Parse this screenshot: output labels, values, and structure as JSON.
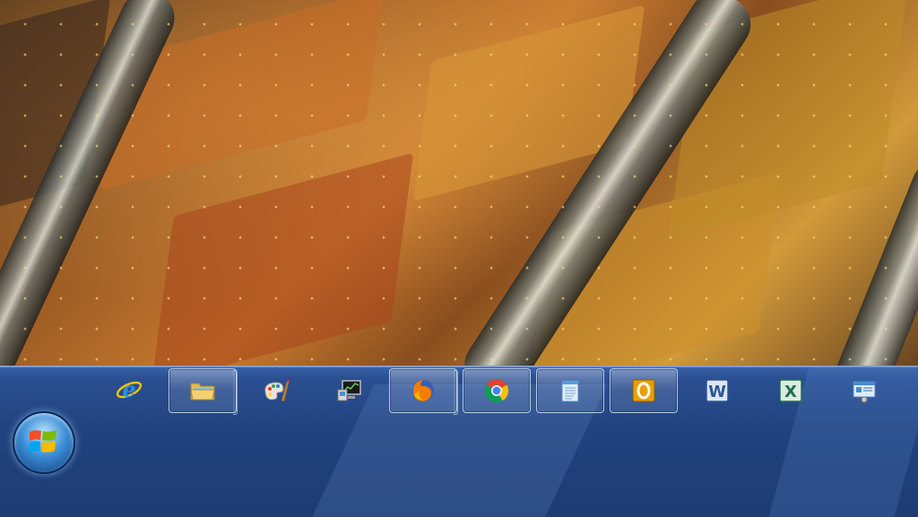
{
  "desktop": {
    "wallpaper": "woven-orange-abstract"
  },
  "taskbar": {
    "start_button": {
      "icon": "windows-logo-icon"
    },
    "items": [
      {
        "name": "internet-explorer",
        "icon": "internet-explorer-icon",
        "active": false
      },
      {
        "name": "windows-explorer",
        "icon": "folder-icon",
        "active": true
      },
      {
        "name": "paint",
        "icon": "paint-palette-icon",
        "active": false
      },
      {
        "name": "remote-desktop",
        "icon": "monitor-icon",
        "active": false
      },
      {
        "name": "firefox",
        "icon": "firefox-icon",
        "active": true
      },
      {
        "name": "chrome",
        "icon": "chrome-icon",
        "active": true
      },
      {
        "name": "notepad",
        "icon": "notepad-icon",
        "active": true
      },
      {
        "name": "outlook",
        "icon": "outlook-icon",
        "active": true
      },
      {
        "name": "word",
        "icon": "word-icon",
        "active": false
      },
      {
        "name": "excel",
        "icon": "excel-icon",
        "active": false
      },
      {
        "name": "control-panel",
        "icon": "control-panel-icon",
        "active": false
      }
    ]
  },
  "colors": {
    "taskbar": "#22437f",
    "taskbar_border": "#7fa2d6",
    "word": "#2b5797",
    "excel": "#1e7145",
    "outlook": "#e8a000"
  }
}
